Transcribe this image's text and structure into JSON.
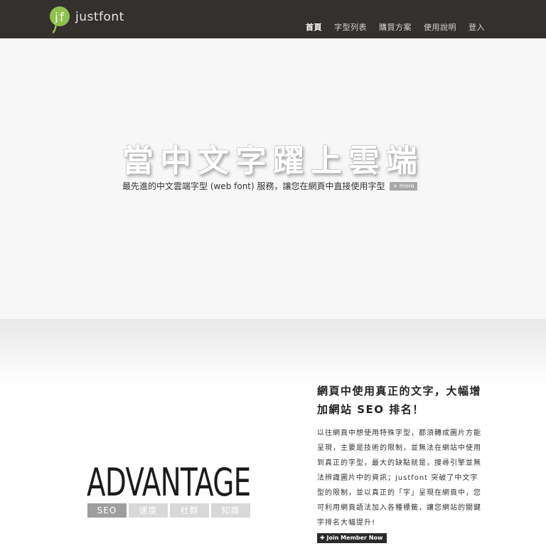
{
  "header": {
    "logo_text": "justfont",
    "nav": [
      {
        "label": "首頁",
        "active": true
      },
      {
        "label": "字型列表"
      },
      {
        "label": "購買方案"
      },
      {
        "label": "使用說明"
      },
      {
        "label": "登入"
      }
    ]
  },
  "hero": {
    "title": "當中文字躍上雲端",
    "subtitle": "最先進的中文雲端字型 (web font) 服務，讓您在網頁中直接使用字型",
    "more_label": "+ more"
  },
  "advantage": {
    "title": "ADVANTAGE",
    "tabs": [
      {
        "label": "SEO",
        "active": true
      },
      {
        "label": "速度"
      },
      {
        "label": "社群"
      },
      {
        "label": "知識"
      }
    ]
  },
  "content": {
    "heading": "網頁中使用真正的文字，大幅增加網站 SEO 排名！",
    "body": "以往網頁中想使用特殊字型，都須轉成圖片方能呈現，主要是技術的限制，並無法在網站中使用到真正的字型，最大的缺點就是，搜尋引擎並無法辨識圖片中的資訊；justfont 突破了中文字型的限制，並以真正的「字」呈現在網頁中，您可利用網頁語法加入各種標籤，讓您網站的關鍵字排名大幅提升!",
    "join_label": "✚ Join Member Now"
  },
  "colors": {
    "header_bg": "#33302d",
    "logo_green": "#8fc14c",
    "hero_bg": "#f7f7f8",
    "tab_active": "#9e9e9e",
    "tab_inactive": "#d8d8d8"
  }
}
